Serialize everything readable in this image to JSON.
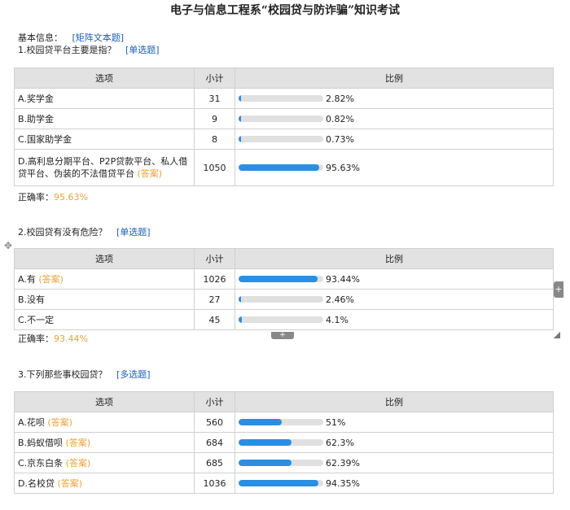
{
  "title": "电子与信息工程系“校园贷与防诈骗”知识考试",
  "basic_info": {
    "label": "基本信息：",
    "tag": "[矩阵文本题]"
  },
  "table_headers": {
    "option": "选项",
    "count": "小计",
    "ratio": "比例"
  },
  "colors": {
    "bar_fill": "#2a8ee4",
    "bar_bg": "#e0e0e0",
    "answer": "#e8a33d",
    "link": "#1a5fb4",
    "header_bg": "#e2e2e2"
  },
  "questions": [
    {
      "title": "1.校园贷平台主要是指？",
      "type": "[单选题]",
      "rows": [
        {
          "option": "A.奖学金",
          "answer": "",
          "count": "31",
          "fraction": 0.0282,
          "percent": "2.82%"
        },
        {
          "option": "B.助学金",
          "answer": "",
          "count": "9",
          "fraction": 0.0082,
          "percent": "0.82%"
        },
        {
          "option": "C.国家助学金",
          "answer": "",
          "count": "8",
          "fraction": 0.0073,
          "percent": "0.73%"
        },
        {
          "option": "D.高利息分期平台、P2P贷款平台、私人借贷平台、伪装的不法借贷平台",
          "answer": "(答案)",
          "count": "1050",
          "fraction": 0.9563,
          "percent": "95.63%"
        }
      ],
      "correct_label": "正确率：",
      "correct_rate": "95.63%"
    },
    {
      "title": "2.校园贷有没有危险？",
      "type": "[单选题]",
      "rows": [
        {
          "option": "A.有",
          "answer": "(答案)",
          "count": "1026",
          "fraction": 0.9344,
          "percent": "93.44%"
        },
        {
          "option": "B.没有",
          "answer": "",
          "count": "27",
          "fraction": 0.0246,
          "percent": "2.46%"
        },
        {
          "option": "C.不一定",
          "answer": "",
          "count": "45",
          "fraction": 0.041,
          "percent": "4.1%"
        }
      ],
      "correct_label": "正确率：",
      "correct_rate": "93.44%"
    },
    {
      "title": "3.下列那些事校园贷？",
      "type": "[多选题]",
      "rows": [
        {
          "option": "A.花呗",
          "answer": "(答案)",
          "count": "560",
          "fraction": 0.51,
          "percent": "51%"
        },
        {
          "option": "B.蚂蚁借呗",
          "answer": "(答案)",
          "count": "684",
          "fraction": 0.623,
          "percent": "62.3%"
        },
        {
          "option": "C.京东白条",
          "answer": "(答案)",
          "count": "685",
          "fraction": 0.6239,
          "percent": "62.39%"
        },
        {
          "option": "D.名校贷",
          "answer": "(答案)",
          "count": "1036",
          "fraction": 0.9435,
          "percent": "94.35%"
        }
      ]
    }
  ],
  "controls": {
    "move_icon": "move-icon",
    "side_plus": "+",
    "bottom_plus": "+"
  }
}
